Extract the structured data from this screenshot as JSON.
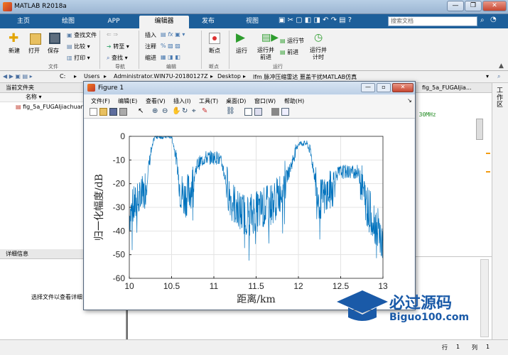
{
  "app": {
    "title": "MATLAB R2018a",
    "window_buttons": [
      "—",
      "❐",
      "✕"
    ]
  },
  "tabs": [
    "主页",
    "绘图",
    "APP",
    "编辑器",
    "发布",
    "视图"
  ],
  "active_tab": "编辑器",
  "search": {
    "placeholder": "搜索文档"
  },
  "ribbon": {
    "file": {
      "new": "新建",
      "open": "打开",
      "save": "保存",
      "find_files": "查找文件",
      "compare": "比较",
      "print": "打印",
      "section": "文件"
    },
    "nav": {
      "goto": "转至",
      "find": "查找",
      "section": "导航"
    },
    "edit": {
      "insert": "插入",
      "comment": "注释",
      "indent": "缩进",
      "fx": "fx",
      "section": "编辑"
    },
    "breakpoints": {
      "label": "断点",
      "section": "断点"
    },
    "run": {
      "run": "运行",
      "run_advance": "运行并\n前进",
      "run_section": "运行节",
      "advance": "前进",
      "run_time": "运行并\n计时",
      "section": "运行"
    }
  },
  "address": {
    "parts": [
      "C:",
      "Users",
      "Administrator.WIN7U-20180127Z",
      "Desktop",
      "lfm 脉冲压缩雷达 噩盖干扰MATLAB仿真"
    ]
  },
  "current_folder": {
    "header": "当前文件夹",
    "col_name": "名称",
    "file": "fig_5a_FUGAIjiachuan"
  },
  "details": {
    "header": "详细信息",
    "message": "选择文件以查看详细"
  },
  "editor": {
    "tab": "fig_5a_FUGAIjia...",
    "code": "n 30MHz",
    "label": "工作区"
  },
  "status": {
    "row_label": "行",
    "row": "1",
    "col_label": "列",
    "col": "1"
  },
  "figure": {
    "title": "Figure 1",
    "menus": [
      "文件(F)",
      "编辑(E)",
      "查看(V)",
      "插入(I)",
      "工具(T)",
      "桌面(D)",
      "窗口(W)",
      "帮助(H)"
    ]
  },
  "chart_data": {
    "type": "line",
    "xlabel": "距离/km",
    "ylabel": "归一化幅度/dB",
    "xlim": [
      10,
      13
    ],
    "ylim": [
      -60,
      0
    ],
    "xticks": [
      "10",
      "10.5",
      "11",
      "11.5",
      "12",
      "12.5",
      "13"
    ],
    "yticks": [
      "0",
      "-10",
      "-20",
      "-30",
      "-40",
      "-50",
      "-60"
    ],
    "grid": true,
    "color": "#0072bd",
    "series": [
      {
        "x": [
          10,
          10.05,
          10.1,
          10.15,
          10.2,
          10.25,
          10.3,
          10.5,
          10.55,
          10.6,
          10.65,
          10.7,
          10.75,
          10.8,
          10.9,
          11.05,
          11.1,
          11.15,
          11.2,
          11.3,
          11.4,
          11.5,
          11.6,
          11.7,
          11.75,
          11.8,
          11.85,
          11.9,
          11.95,
          12.0,
          12.1,
          12.15,
          12.2,
          12.25,
          12.3,
          12.35,
          12.4,
          12.45,
          12.5,
          12.55,
          12.7,
          12.75,
          12.8,
          12.85,
          12.9,
          12.95,
          13.0
        ],
        "y": [
          -33,
          -30,
          -28,
          -26,
          -20,
          -8,
          0,
          0,
          -8,
          -22,
          -26,
          -24,
          -20,
          -12,
          -9,
          -9,
          -12,
          -20,
          -26,
          -32,
          -33,
          -32,
          -30,
          -28,
          -26,
          -22,
          -18,
          -14,
          -8,
          -3,
          -3,
          -8,
          -18,
          -27,
          -26,
          -24,
          -22,
          -16,
          -15,
          -15,
          -15,
          -20,
          -28,
          -32,
          -36,
          -40,
          -47
        ]
      }
    ]
  },
  "watermark": {
    "brand": "必过源码",
    "url": "Biguo100.com"
  }
}
